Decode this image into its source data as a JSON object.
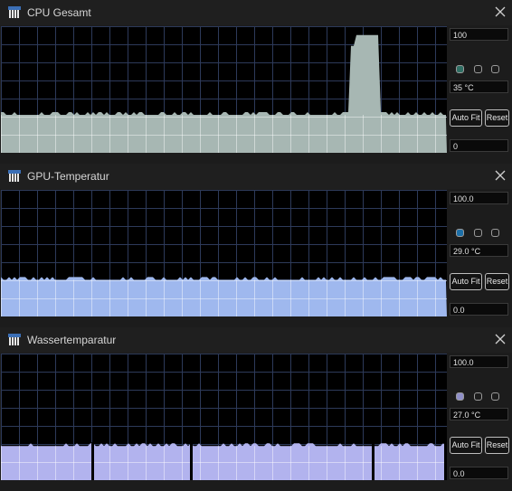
{
  "panels": [
    {
      "title": "CPU Gesamt",
      "max_value": "100",
      "current_value": "35 °C",
      "min_value": "0",
      "auto_fit_label": "Auto Fit",
      "reset_label": "Reset",
      "graph_color": "#a7b7b3",
      "selected_color": "#2f6f64",
      "fill_level": 0.3,
      "spike_level": 0.93
    },
    {
      "title": "GPU-Temperatur",
      "max_value": "100.0",
      "current_value": "29.0 °C",
      "min_value": "0.0",
      "auto_fit_label": "Auto Fit",
      "reset_label": "Reset",
      "graph_color": "#9fb8ee",
      "selected_color": "#1c6fa8",
      "fill_level": 0.29
    },
    {
      "title": "Wassertemparatur",
      "max_value": "100.0",
      "current_value": "27.0 °C",
      "min_value": "0.0",
      "auto_fit_label": "Auto Fit",
      "reset_label": "Reset",
      "graph_color": "#b2b3ee",
      "selected_color": "#8f8fc8",
      "fill_level": 0.27
    }
  ]
}
